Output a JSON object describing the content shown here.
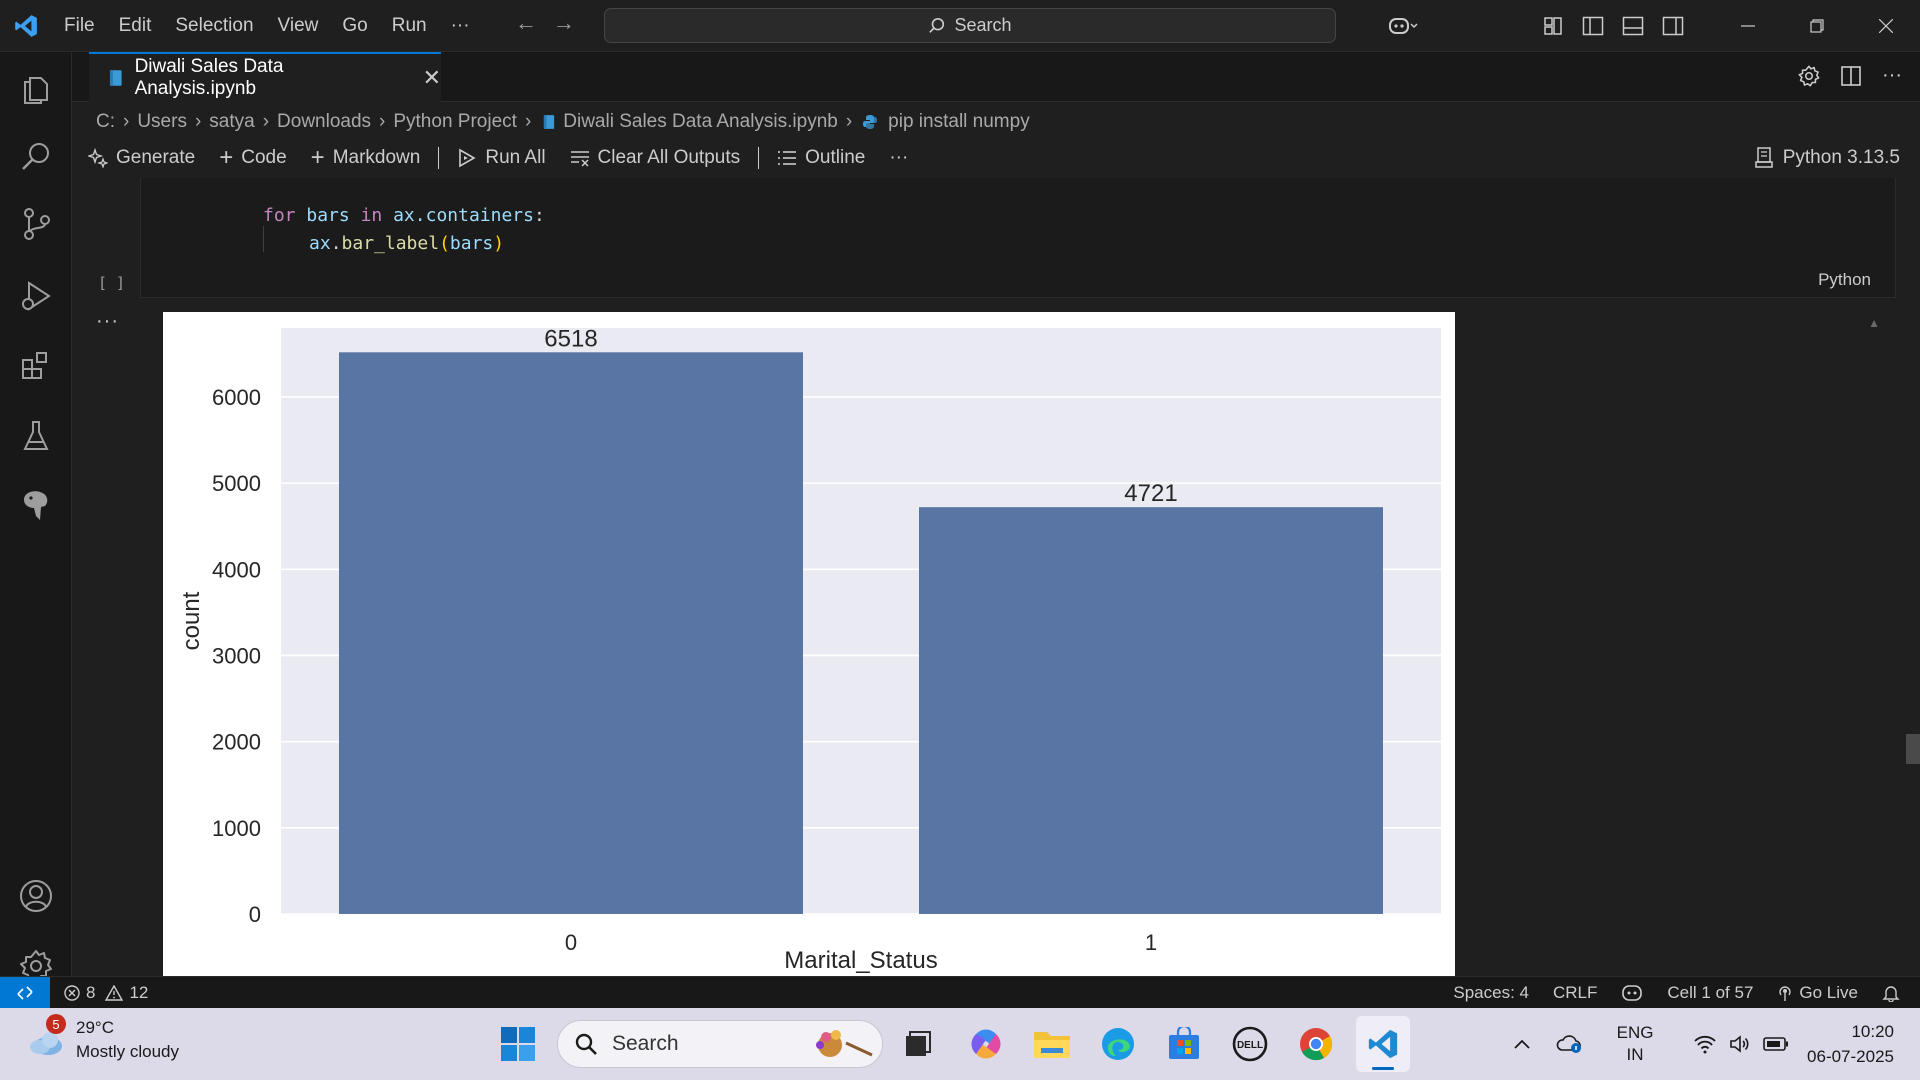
{
  "titlebar": {
    "menu": [
      "File",
      "Edit",
      "Selection",
      "View",
      "Go",
      "Run",
      "···"
    ],
    "search_label": "Search"
  },
  "tab": {
    "label": "Diwali Sales Data Analysis.ipynb",
    "close": "✕"
  },
  "breadcrumb": [
    "C:",
    "Users",
    "satya",
    "Downloads",
    "Python Project",
    "Diwali Sales Data Analysis.ipynb",
    "pip install numpy"
  ],
  "toolbar": {
    "generate": "Generate",
    "code": "Code",
    "markdown": "Markdown",
    "run_all": "Run All",
    "clear_outputs": "Clear All Outputs",
    "outline": "Outline",
    "more": "···",
    "kernel": "Python 3.13.5"
  },
  "cell": {
    "line1": {
      "kw": "for",
      "v1": "bars",
      "kw2": "in",
      "v2": "ax.containers",
      "p": ":"
    },
    "line2": {
      "obj": "ax",
      "fn": "bar_label",
      "arg": "bars"
    },
    "exec_count": "[ ]",
    "language": "Python",
    "output_menu": "···"
  },
  "chart_data": {
    "type": "bar",
    "categories": [
      "0",
      "1"
    ],
    "values": [
      6518,
      4721
    ],
    "data_labels": [
      "6518",
      "4721"
    ],
    "xlabel": "Marital_Status",
    "ylabel": "count",
    "ylim": [
      0,
      6800
    ],
    "yticks": [
      0,
      1000,
      2000,
      3000,
      4000,
      5000,
      6000
    ],
    "grid": true,
    "bar_color": "#5975a4",
    "background_color": "#eaeaf2"
  },
  "statusbar": {
    "errors": "8",
    "warnings": "12",
    "spaces": "Spaces: 4",
    "eol": "CRLF",
    "cell_pos": "Cell 1 of 57",
    "go_live": "Go Live"
  },
  "taskbar": {
    "weather_badge": "5",
    "temperature": "29°C",
    "weather_desc": "Mostly cloudy",
    "search_label": "Search",
    "lang_top": "ENG",
    "lang_bottom": "IN",
    "time": "10:20",
    "date": "06-07-2025"
  },
  "colors": {
    "accent": "#0078d4",
    "editor_bg": "#1f1f1f",
    "taskbar_bg": "#dcd9e8"
  }
}
